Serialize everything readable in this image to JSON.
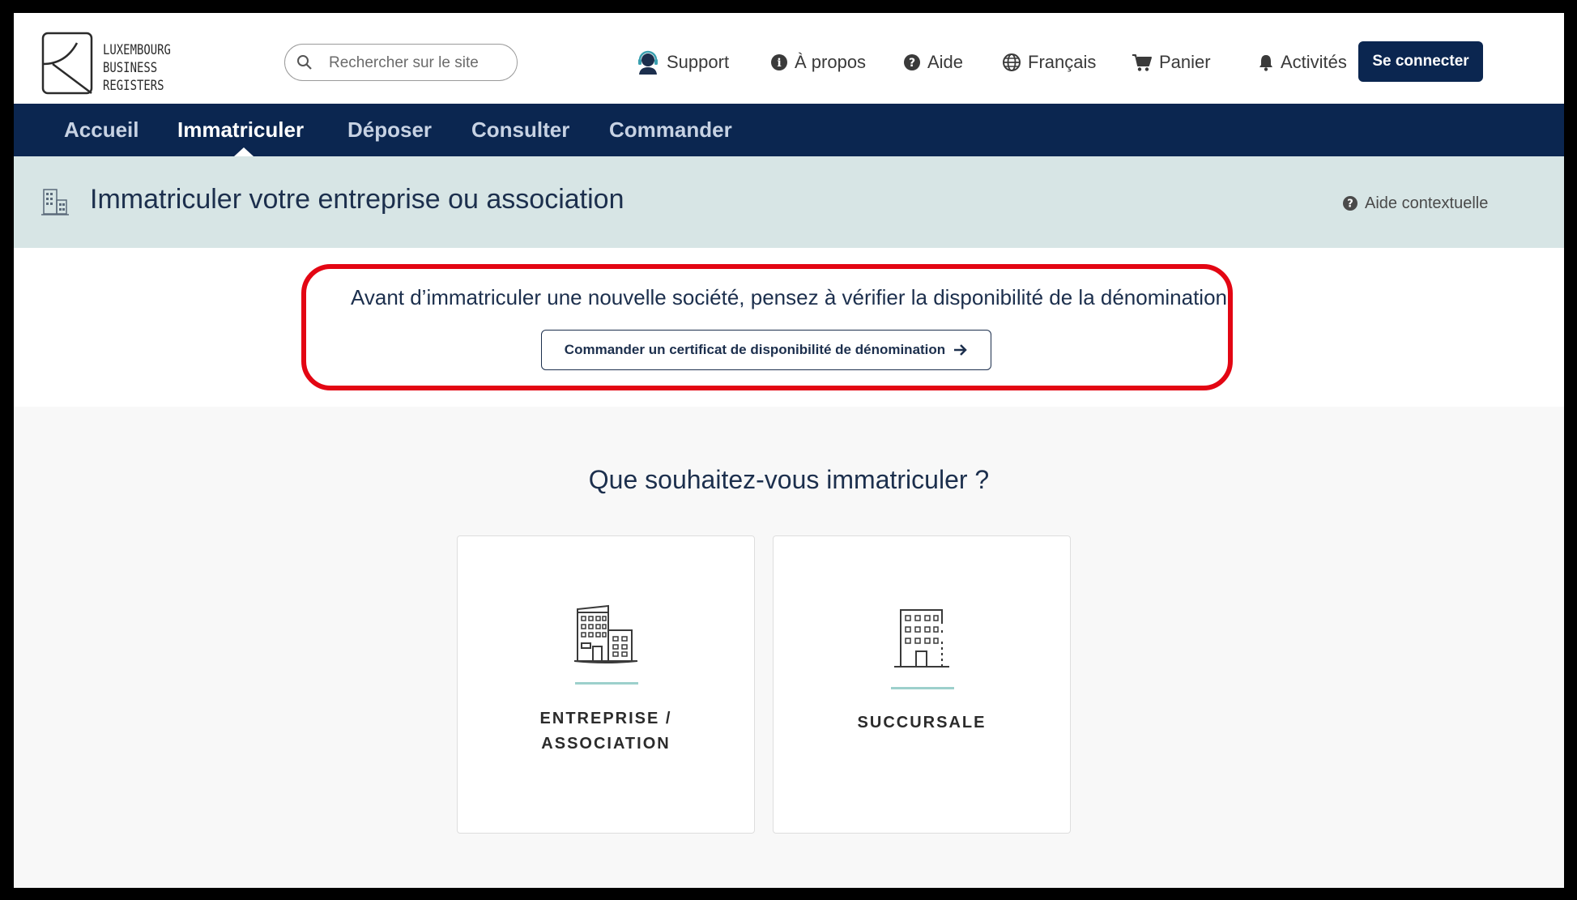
{
  "brand": {
    "logo_lines": [
      "LUXEMBOURG",
      "BUSINESS",
      "REGISTERS"
    ]
  },
  "search": {
    "placeholder": "Rechercher sur le site"
  },
  "header_nav": [
    {
      "label": "Support",
      "icon": "headset-icon"
    },
    {
      "label": "À propos",
      "icon": "info-icon"
    },
    {
      "label": "Aide",
      "icon": "question-icon"
    },
    {
      "label": "Français",
      "icon": "globe-icon"
    },
    {
      "label": "Panier",
      "icon": "cart-icon"
    },
    {
      "label": "Activités",
      "icon": "bell-icon"
    }
  ],
  "login": {
    "label": "Se connecter"
  },
  "main_nav": {
    "items": [
      "Accueil",
      "Immatriculer",
      "Déposer",
      "Consulter",
      "Commander"
    ],
    "active": "Immatriculer"
  },
  "page_header": {
    "title": "Immatriculer votre entreprise ou association",
    "help_label": "Aide contextuelle"
  },
  "notice": {
    "text": "Avant d’immatriculer une nouvelle société, pensez à vérifier la disponibilité de la dénomination",
    "button_label": "Commander un certificat de disponibilité de dénomination"
  },
  "question": "Que souhaitez-vous immatriculer ?",
  "options": [
    {
      "label_line1": "ENTREPRISE /",
      "label_line2": "ASSOCIATION",
      "icon": "buildings-icon"
    },
    {
      "label_line1": "SUCCURSALE",
      "icon": "building-icon"
    }
  ],
  "colors": {
    "navy": "#0b2650",
    "header_band": "#d7e5e5",
    "highlight": "#e30613",
    "accent_line": "#9dd0cc"
  }
}
